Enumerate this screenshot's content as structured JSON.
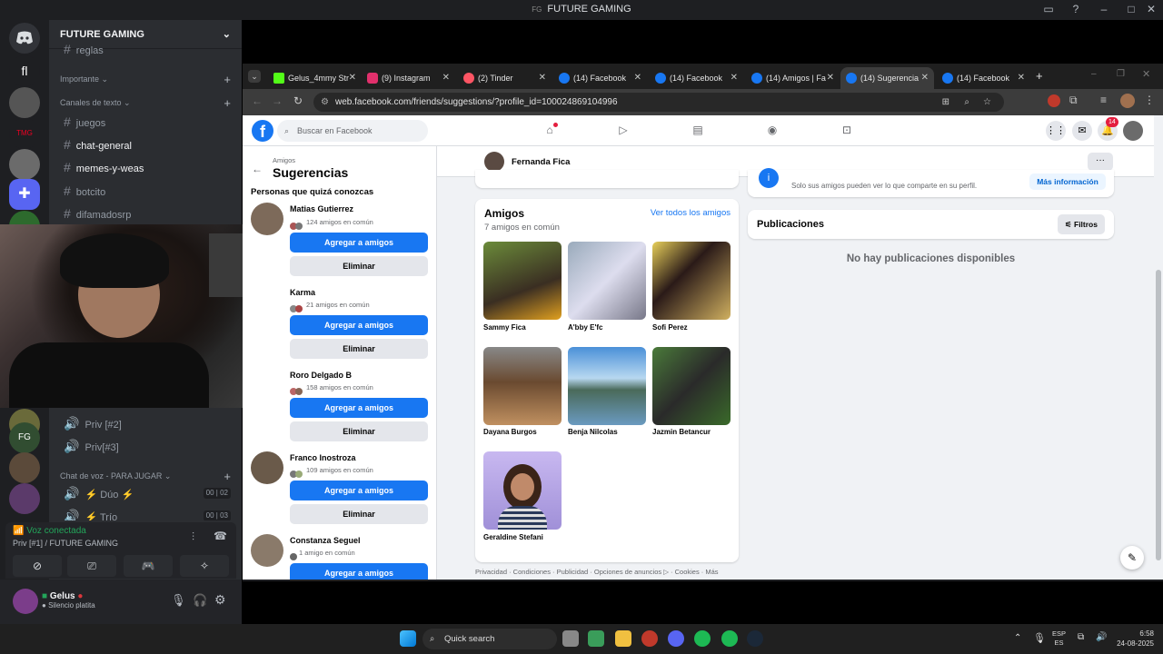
{
  "window": {
    "title": "FUTURE GAMING",
    "badge": "FG"
  },
  "discord": {
    "guild_name": "FUTURE GAMING",
    "partial_channel": "reglas",
    "categories": {
      "important": "Importante",
      "text": "Canales de texto",
      "voice": "Chat de voz - PARA JUGAR"
    },
    "text_channels": [
      "juegos",
      "chat-general",
      "memes-y-weas",
      "botcito",
      "difamadosrp"
    ],
    "voice_channels": [
      "Priv [#2]",
      "Priv[#3]"
    ],
    "voice_rooms": [
      {
        "name": "Dúo",
        "count_a": "00",
        "count_b": "02"
      },
      {
        "name": "Trío",
        "count_a": "00",
        "count_b": "03"
      }
    ],
    "voice_status": {
      "title": "Voz conectada",
      "location": "Priv [#1] / FUTURE GAMING"
    },
    "user": {
      "name": "Gelus",
      "status": "Silencio platita"
    },
    "server_labels": {
      "home": "",
      "tmg": "TMG"
    }
  },
  "browser": {
    "tabs": [
      {
        "label": "Gelus_4mmy Str",
        "color": "#53fc18"
      },
      {
        "label": "(9) Instagram",
        "color": "#e1306c"
      },
      {
        "label": "(2) Tinder",
        "color": "#fd5564"
      },
      {
        "label": "(14) Facebook",
        "color": "#1877f2"
      },
      {
        "label": "(14) Facebook",
        "color": "#1877f2"
      },
      {
        "label": "(14) Amigos | Fa",
        "color": "#1877f2"
      },
      {
        "label": "(14) Sugerencia",
        "color": "#1877f2"
      },
      {
        "label": "(14) Facebook",
        "color": "#1877f2"
      }
    ],
    "url": "web.facebook.com/friends/suggestions/?profile_id=100024869104996"
  },
  "facebook": {
    "search_placeholder": "Buscar en Facebook",
    "notif_count": "14",
    "sidebar": {
      "breadcrumb": "Amigos",
      "title": "Sugerencias",
      "subtitle": "Personas que quizá conozcas",
      "add_label": "Agregar a amigos",
      "remove_label": "Eliminar",
      "people": [
        {
          "name": "Matias Gutierrez",
          "mutual": "124 amigos en común"
        },
        {
          "name": "Karma",
          "mutual": "21 amigos en común"
        },
        {
          "name": "Roro Delgado B",
          "mutual": "158 amigos en común"
        },
        {
          "name": "Franco Inostroza",
          "mutual": "109 amigos en común"
        },
        {
          "name": "Constanza Seguel",
          "mutual": "1 amigo en común"
        }
      ]
    },
    "profile": {
      "name": "Fernanda Fica",
      "privacy_note": "Solo sus amigos pueden ver lo que comparte en su perfil.",
      "more_info": "Más información",
      "friends_title": "Amigos",
      "friends_mutual": "7 amigos en común",
      "see_all": "Ver todos los amigos",
      "friends": [
        "Sammy Fica",
        "A'bby E'fc",
        "Sofi Perez",
        "Dayana Burgos",
        "Benja Nilcolas",
        "Jazmin Betancur",
        "Geraldine Stefani"
      ],
      "posts_title": "Publicaciones",
      "filters": "Filtros",
      "no_posts": "No hay publicaciones disponibles",
      "footer": "Privacidad · Condiciones · Publicidad · Opciones de anuncios ▷ · Cookies · Más"
    }
  },
  "taskbar": {
    "search": "Quick search",
    "lang_top": "ESP",
    "lang_bottom": "ES",
    "time": "6:58",
    "date": "24-08-2025"
  }
}
